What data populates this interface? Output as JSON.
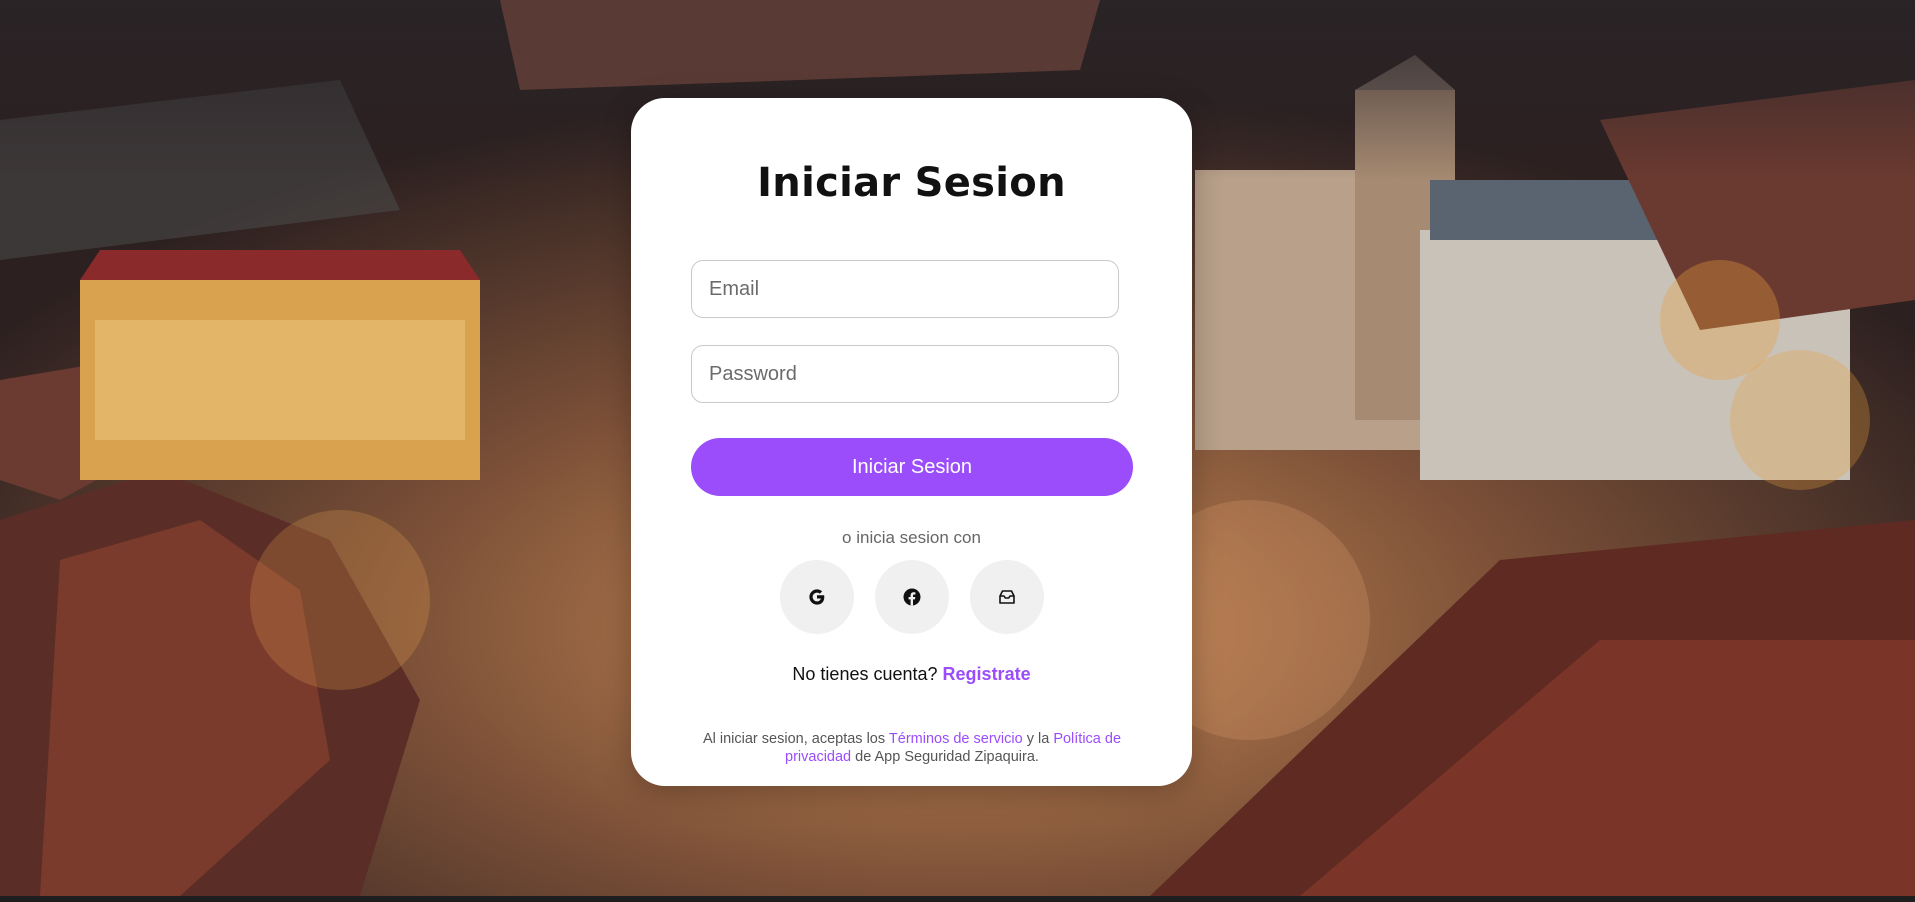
{
  "login": {
    "title": "Iniciar Sesion",
    "email_placeholder": "Email",
    "password_placeholder": "Password",
    "submit_label": "Iniciar Sesion",
    "alt_text": "o inicia sesion con",
    "social": [
      {
        "name": "google",
        "icon": "google-icon"
      },
      {
        "name": "facebook",
        "icon": "facebook-icon"
      },
      {
        "name": "email",
        "icon": "mail-inbox-icon"
      }
    ],
    "register_prompt": "No tienes cuenta?",
    "register_link": "Registrate",
    "terms_prefix": "Al iniciar sesion, aceptas los",
    "terms_link": "Términos de servicio",
    "terms_middle": "y la",
    "privacy_link": "Política de privacidad",
    "terms_suffix": "de App Seguridad Zipaquira."
  },
  "colors": {
    "accent": "#9b4dfb",
    "card": "#ffffff",
    "social_button": "#f0f0f0"
  }
}
